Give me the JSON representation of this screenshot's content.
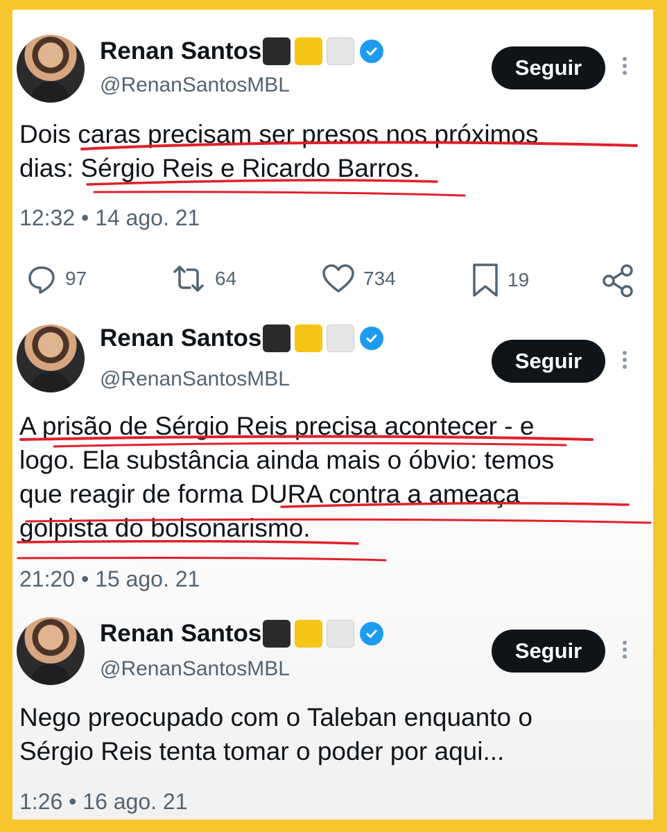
{
  "tweets": [
    {
      "author": "Renan Santos",
      "handle": "@RenanSantosMBL",
      "follow_label": "Seguir",
      "text_lines": [
        "Dois caras precisam ser presos nos próximos",
        "dias: Sérgio Reis e Ricardo Barros."
      ],
      "timestamp": "12:32 • 14 ago. 21",
      "stats": {
        "replies": "97",
        "retweets": "64",
        "likes": "734",
        "bookmarks": "19"
      }
    },
    {
      "author": "Renan Santos",
      "handle": "@RenanSantosMBL",
      "follow_label": "Seguir",
      "text_lines": [
        "A prisão de Sérgio Reis precisa acontecer - e",
        "logo. Ela substância ainda mais o óbvio: temos",
        "que reagir de forma DURA contra a ameaça",
        "golpista do bolsonarismo."
      ],
      "timestamp": "21:20 • 15 ago. 21"
    },
    {
      "author": "Renan Santos",
      "handle": "@RenanSantosMBL",
      "follow_label": "Seguir",
      "text_lines": [
        "Nego preocupado com o Taleban enquanto o",
        "Sérgio Reis tenta tomar o poder por aqui..."
      ],
      "timestamp": "1:26 • 16 ago. 21"
    }
  ],
  "icons": {
    "name_flags": [
      "black-square",
      "yellow-square",
      "white-square"
    ],
    "verified": "verified-badge-icon",
    "actions": [
      "reply-icon",
      "retweet-icon",
      "like-icon",
      "bookmark-icon",
      "share-icon"
    ]
  },
  "colors": {
    "frame": "#f7c62f",
    "text": "#0f1419",
    "secondary": "#536471",
    "verified": "#1d9bf0",
    "underline": "#e0202a"
  }
}
